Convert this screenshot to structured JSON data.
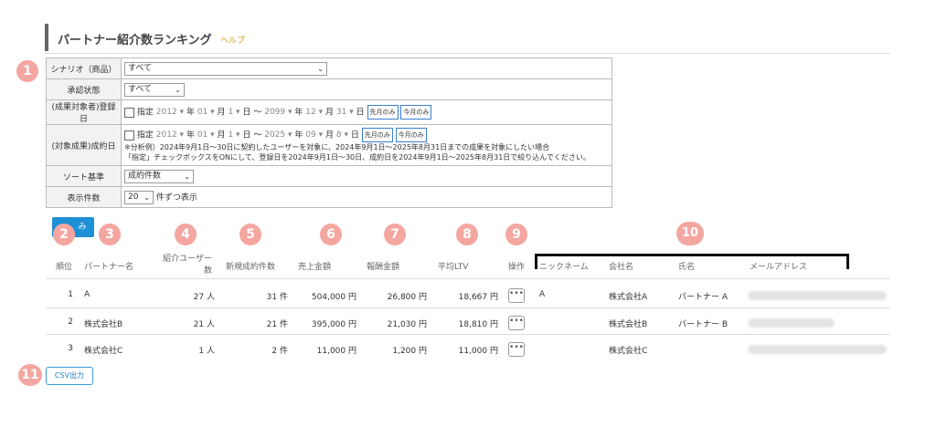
{
  "header": {
    "title": "パートナー紹介数ランキング",
    "help": "ヘルプ"
  },
  "filters": {
    "scenario_label": "シナリオ（商品）",
    "scenario_value": "すべて",
    "approval_label": "承認状態",
    "approval_value": "すべて",
    "regdate_label": "(成果対象者)登録日",
    "specify": "指定",
    "reg_from_year": "2012",
    "reg_from_month": "01",
    "reg_from_day": "1",
    "reg_to_year": "2099",
    "reg_to_month": "12",
    "reg_to_day": "31",
    "unit_year": "年",
    "unit_month": "月",
    "unit_day": "日",
    "tilde": "～",
    "last_month_btn": "先月のみ",
    "this_month_btn": "今月のみ",
    "contract_label": "(対象成果)成約日",
    "con_from_year": "2012",
    "con_from_month": "01",
    "con_from_day": "1",
    "con_to_year": "2025",
    "con_to_month": "09",
    "con_to_day": "8",
    "note1": "※分析例）2024年9月1日～30日に契約したユーザーを対象に、2024年9月1日～2025年8月31日までの成果を対象にしたい場合",
    "note2": "「指定」チェックボックスをONにして、登録日を2024年9月1日～30日、成約日を2024年9月1日～2025年8月31日で絞り込んでください。",
    "sort_label": "ソート基準",
    "sort_value": "成約件数",
    "count_label": "表示件数",
    "count_value": "20",
    "count_suffix": "件ずつ表示"
  },
  "go_button": "み",
  "badges": [
    "1",
    "2",
    "3",
    "4",
    "5",
    "6",
    "7",
    "8",
    "9",
    "10",
    "11"
  ],
  "columns": {
    "rank": "順位",
    "partner": "パートナー名",
    "referred1": "紹介ユーザー",
    "referred2": "数",
    "new_contracts": "新規成約件数",
    "sales": "売上金額",
    "reward": "報酬金額",
    "ltv": "平均LTV",
    "ops": "操作",
    "nickname": "ニックネーム",
    "company": "会社名",
    "name": "氏名",
    "email": "メールアドレス"
  },
  "rows": [
    {
      "rank": "1",
      "partner": "A",
      "referred": "27 人",
      "contracts": "31 件",
      "sales": "504,000 円",
      "reward": "26,800 円",
      "ltv": "18,667 円",
      "nickname": "A",
      "company": "株式会社A",
      "name": "パートナー A"
    },
    {
      "rank": "2",
      "partner": "株式会社B",
      "referred": "21 人",
      "contracts": "21 件",
      "sales": "395,000 円",
      "reward": "21,030 円",
      "ltv": "18,810 円",
      "nickname": "",
      "company": "株式会社B",
      "name": "パートナー B"
    },
    {
      "rank": "3",
      "partner": "株式会社C",
      "referred": "1 人",
      "contracts": "2 件",
      "sales": "11,000 円",
      "reward": "1,200 円",
      "ltv": "11,000 円",
      "nickname": "",
      "company": "株式会社C",
      "name": ""
    }
  ],
  "ops_icon": "•••",
  "csv_button": "CSV出力"
}
